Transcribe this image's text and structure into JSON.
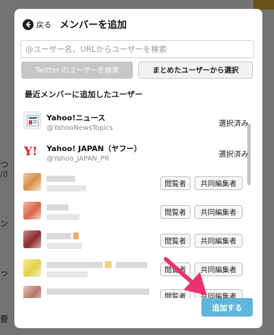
{
  "background": {
    "texts": [
      "つ",
      "/8",
      "ン",
      "っ",
      "要"
    ]
  },
  "modal": {
    "back_label": "戻る",
    "title": "メンバーを追加",
    "search_placeholder": "@ユーザー名、URLからユーザーを検索",
    "twitter_button": "Twitter のユーザーを検索",
    "select_button": "まとめたユーザーから選択",
    "section_label": "最近メンバーに追加したユーザー",
    "rows": [
      {
        "name": "Yahoo!ニュース",
        "handle": "@YahooNewsTopics",
        "status": "選択済み"
      },
      {
        "name": "Yahoo! JAPAN（ヤフー）",
        "handle": "@Yahoo_JAPAN_PR",
        "status": "選択済み"
      }
    ],
    "role_viewer": "閲覧者",
    "role_editor": "共同編集者",
    "add_button": "追加する"
  },
  "colors": {
    "accent": "#5fb6dd",
    "arrow": "#e8336d"
  },
  "icons": {
    "back": "arrow-left-circle-icon",
    "news": "news-paper-icon",
    "yahoo": "yahoo-logo-icon"
  }
}
